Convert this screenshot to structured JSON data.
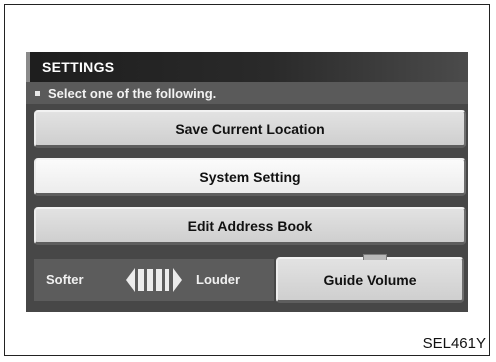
{
  "header": {
    "title": "SETTINGS",
    "instruction": "Select one of the following."
  },
  "menu": {
    "items": [
      {
        "label": "Save Current Location"
      },
      {
        "label": "System Setting"
      },
      {
        "label": "Edit Address Book"
      }
    ]
  },
  "volume": {
    "softer_label": "Softer",
    "louder_label": "Louder",
    "guide_label": "Guide Volume"
  },
  "figure_code": "SEL461Y"
}
